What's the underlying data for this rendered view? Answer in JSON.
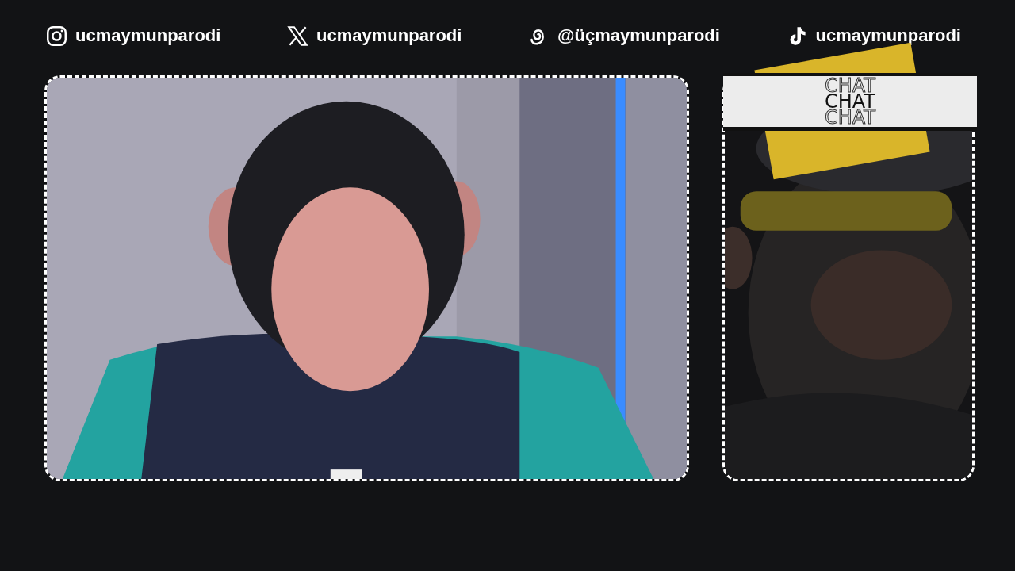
{
  "socials": [
    {
      "kind": "camera",
      "handle": "ucmaymunparodi"
    },
    {
      "kind": "x",
      "handle": "ucmaymunparodi"
    },
    {
      "kind": "at",
      "handle": "@üçmaymunparodi"
    },
    {
      "kind": "note",
      "handle": "ucmaymunparodi"
    }
  ],
  "chat": {
    "titles": [
      {
        "kind": "outline",
        "text": "CHAT"
      },
      {
        "kind": "solid",
        "text": "CHAT"
      },
      {
        "kind": "outline",
        "text": "CHAT"
      }
    ]
  }
}
